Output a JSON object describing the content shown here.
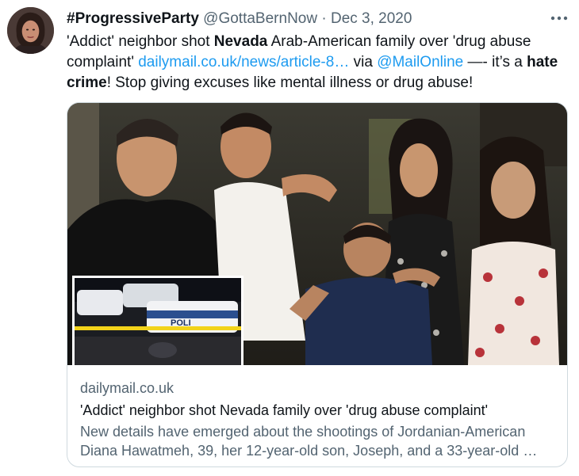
{
  "author": {
    "name": "#ProgressiveParty",
    "handle": "@GottaBernNow",
    "separator": "·",
    "date": "Dec 3, 2020",
    "avatar_icon": "user-avatar"
  },
  "tweet": {
    "seg1": "'Addict' neighbor shot ",
    "bold1": "Nevada",
    "seg2": " Arab-American family over 'drug abuse complaint' ",
    "link": "dailymail.co.uk/news/article-8…",
    "seg3": " via ",
    "mention": "@MailOnline",
    "seg4": " —- it’s a ",
    "bold2": "hate crime",
    "seg5": "! Stop giving excuses like mental illness or drug abuse!"
  },
  "card": {
    "domain": "dailymail.co.uk",
    "title": "'Addict' neighbor shot Nevada family over 'drug abuse complaint'",
    "description": "New details have emerged about the shootings of Jordanian-American Diana Hawatmeh, 39, her 12-year-old son, Joseph, and a 33-year-old …",
    "inset_police_text": "POLI"
  },
  "icons": {
    "more": "more-dots-icon"
  },
  "colors": {
    "link": "#1d9bf0",
    "secondary": "#536471",
    "border": "#cfd9de",
    "text": "#0f1419"
  }
}
